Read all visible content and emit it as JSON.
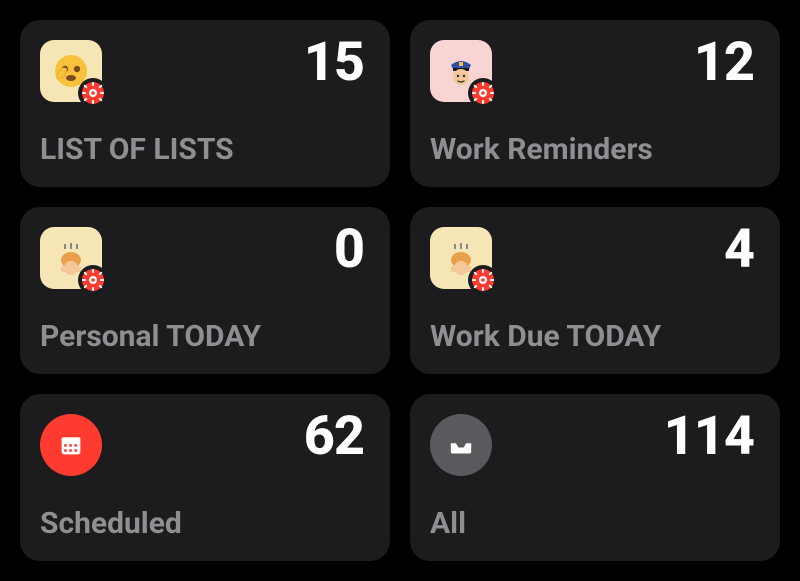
{
  "cards": [
    {
      "label": "LIST OF LISTS",
      "count": "15",
      "icon": "face-peeking",
      "icon_bg": "cream",
      "gear": true,
      "shape": "rounded"
    },
    {
      "label": "Work Reminders",
      "count": "12",
      "icon": "police",
      "icon_bg": "pink",
      "gear": true,
      "shape": "rounded"
    },
    {
      "label": "Personal TODAY",
      "count": "0",
      "icon": "bowing",
      "icon_bg": "cream",
      "gear": true,
      "shape": "rounded"
    },
    {
      "label": "Work Due TODAY",
      "count": "4",
      "icon": "bowing",
      "icon_bg": "cream",
      "gear": true,
      "shape": "rounded"
    },
    {
      "label": "Scheduled",
      "count": "62",
      "icon": "calendar",
      "icon_bg": "red",
      "gear": false,
      "shape": "circle"
    },
    {
      "label": "All",
      "count": "114",
      "icon": "tray",
      "icon_bg": "gray",
      "gear": false,
      "shape": "circle"
    }
  ],
  "colors": {
    "gear_badge": "#ff3b30"
  }
}
